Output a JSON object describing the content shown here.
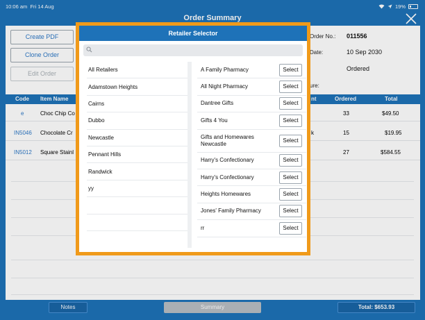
{
  "status": {
    "time": "10:06 am",
    "date": "Fri 14 Aug",
    "battery": "19%"
  },
  "header": {
    "title": "Order Summary"
  },
  "actions": {
    "create_pdf": "Create PDF",
    "clone_order": "Clone Order",
    "edit_order": "Edit Order"
  },
  "order_info": {
    "order_no_label": "Order No.:",
    "order_no": "011556",
    "date_label": "Date:",
    "date": "10 Sep 2030",
    "status": "Ordered",
    "signature_label": "ure:"
  },
  "table": {
    "headers": [
      "Code",
      "Item Name",
      "nt",
      "Ordered",
      "Total"
    ],
    "rows": [
      {
        "code": "e",
        "name": "Choc Chip Co",
        "ordered": "33",
        "total": "$49.50"
      },
      {
        "code": "IN5046",
        "name": "Chocolate Cr",
        "discount": "k",
        "ordered": "15",
        "total": "$19.95"
      },
      {
        "code": "IN5012",
        "name": "Square Stainl",
        "ordered": "27",
        "total": "$584.55"
      }
    ]
  },
  "footer": {
    "notes": "Notes",
    "summary": "Summary",
    "total": "Total: $653.93"
  },
  "modal": {
    "title": "Retailer Selector",
    "search_placeholder": "",
    "regions": [
      "All Retailers",
      "Adamstown Heights",
      "Cairns",
      "Dubbo",
      "Newcastle",
      "Pennant Hills",
      "Randwick",
      "yy"
    ],
    "retailers": [
      "A Family Pharmacy",
      "All Night Pharmacy",
      "Dantree Gifts",
      "Gifts 4 You",
      "Gifts and Homewares Newcastle",
      "Harry's Confectionary",
      "Harry's Confectionary",
      "Heights Homewares",
      "Jones' Family Pharmacy",
      "rr"
    ],
    "select_label": "Select"
  },
  "colors": {
    "brand_blue": "#1e72b8",
    "highlight_orange": "#f09a1a"
  }
}
